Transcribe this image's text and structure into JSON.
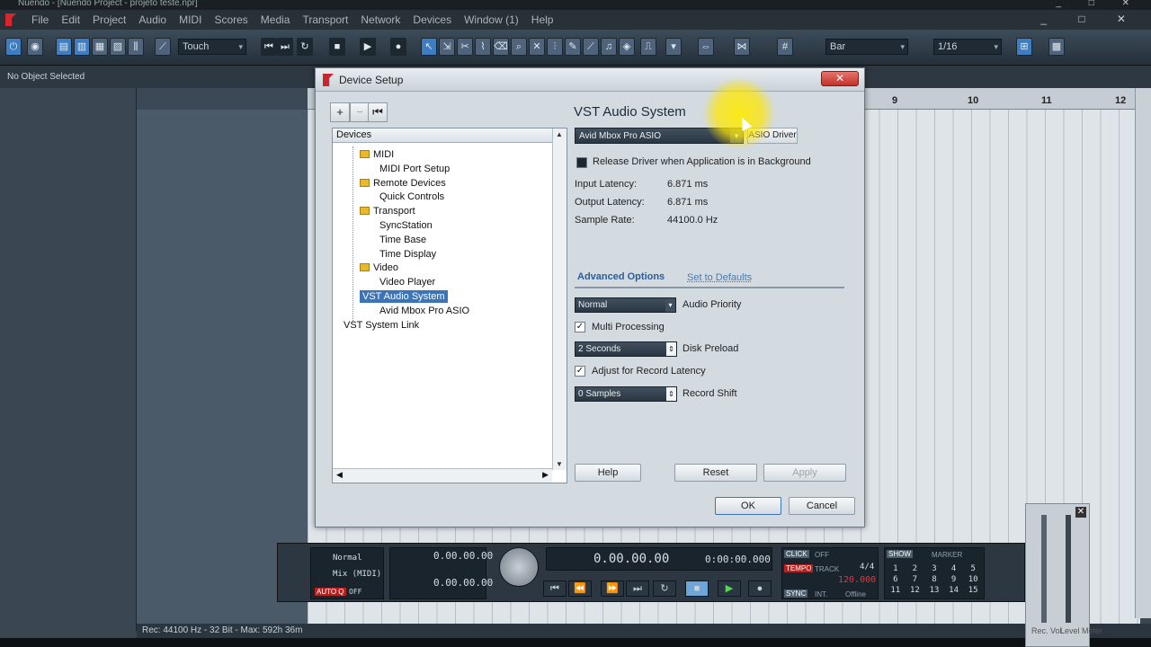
{
  "window": {
    "title": "Nuendo - [Nuendo Project - projeto teste.npr]",
    "controls": "_ □ ✕"
  },
  "menu": [
    "File",
    "Edit",
    "Project",
    "Audio",
    "MIDI",
    "Scores",
    "Media",
    "Transport",
    "Network",
    "Devices",
    "Window (1)",
    "Help"
  ],
  "toolbar": {
    "automation_mode": "Touch",
    "grid_type": "Bar",
    "quantize": "1/16"
  },
  "infoline": {
    "text": "No Object Selected"
  },
  "ruler": [
    "9",
    "10",
    "11",
    "12"
  ],
  "status": {
    "rec": "Rec: 44100 Hz - 32 Bit - Max: 592h 36m"
  },
  "transport": {
    "primary_time": "0.00.00.00",
    "secondary_time": "0:00:00.000",
    "left_locator": "0.00.00.00",
    "right_locator": "0.00.00.00",
    "mode": "Normal",
    "mix": "Mix (MIDI)",
    "auto_q": "AUTO Q",
    "off": "OFF",
    "click": "CLICK",
    "click_state": "OFF",
    "tempo": "TEMPO",
    "track": "TRACK",
    "signature": "4/4",
    "tempo_value": "120.000",
    "sync": "SYNC",
    "int": "INT.",
    "offline": "Offline",
    "show": "SHOW",
    "marker": "MARKER",
    "marker_numbers": [
      "1",
      "2",
      "3",
      "4",
      "5",
      "6",
      "7",
      "8",
      "9",
      "10",
      "11",
      "12",
      "13",
      "14",
      "15"
    ]
  },
  "mixer": {
    "rec_vol": "Rec. Vol.",
    "level_meter": "Level Meter"
  },
  "dialog": {
    "title": "Device Setup",
    "close": "✕",
    "tree_header": "Devices",
    "tree": [
      {
        "label": "MIDI",
        "level": 1,
        "folder": true
      },
      {
        "label": "MIDI Port Setup",
        "level": 2
      },
      {
        "label": "Remote Devices",
        "level": 1,
        "folder": true
      },
      {
        "label": "Quick Controls",
        "level": 2
      },
      {
        "label": "Transport",
        "level": 1,
        "folder": true
      },
      {
        "label": "SyncStation",
        "level": 2
      },
      {
        "label": "Time Base",
        "level": 2
      },
      {
        "label": "Time Display",
        "level": 2
      },
      {
        "label": "Video",
        "level": 1,
        "folder": true
      },
      {
        "label": "Video Player",
        "level": 2
      },
      {
        "label": "VST Audio System",
        "level": 1,
        "selected": true
      },
      {
        "label": "Avid Mbox Pro ASIO",
        "level": 2
      },
      {
        "label": "VST System Link",
        "level": 0
      }
    ],
    "panel": {
      "heading": "VST Audio System",
      "driver": "Avid Mbox Pro ASIO",
      "asio_driver_button": "ASIO Driver",
      "release_driver": "Release Driver when Application is in Background",
      "input_latency_label": "Input Latency:",
      "input_latency": "6.871 ms",
      "output_latency_label": "Output Latency:",
      "output_latency": "6.871 ms",
      "sample_rate_label": "Sample Rate:",
      "sample_rate": "44100.0 Hz",
      "advanced": "Advanced Options",
      "set_defaults": "Set to Defaults",
      "priority_value": "Normal",
      "priority_label": "Audio Priority",
      "multi_processing": "Multi Processing",
      "disk_preload_value": "2 Seconds",
      "disk_preload_label": "Disk Preload",
      "adjust_latency": "Adjust for Record Latency",
      "record_shift_value": "0 Samples",
      "record_shift_label": "Record Shift",
      "help": "Help",
      "reset": "Reset",
      "apply": "Apply"
    },
    "ok": "OK",
    "cancel": "Cancel"
  },
  "colors": {
    "accent": "#3d74b5",
    "tempo_red": "#b42222",
    "logo_red": "#d8262c"
  }
}
